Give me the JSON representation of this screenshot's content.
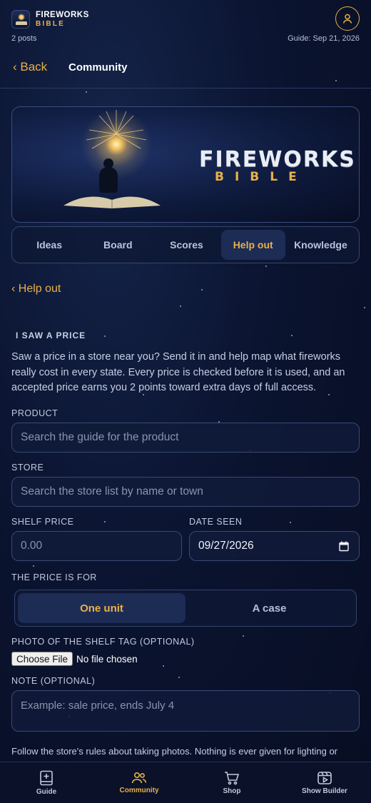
{
  "header": {
    "brand_line1": "FIREWORKS",
    "brand_line2": "BIBLE",
    "posts_count": "2 posts",
    "guide_date": "Guide: Sep 21, 2026"
  },
  "nav": {
    "back_label": "‹ Back",
    "title": "Community"
  },
  "banner": {
    "title": "FIREWORKS",
    "subtitle": "BIBLE"
  },
  "tabs": [
    {
      "label": "Ideas",
      "active": false
    },
    {
      "label": "Board",
      "active": false
    },
    {
      "label": "Scores",
      "active": false
    },
    {
      "label": "Help out",
      "active": true
    },
    {
      "label": "Knowledge",
      "active": false
    }
  ],
  "breadcrumb": "‹ Help out",
  "form": {
    "section_title": "I SAW A PRICE",
    "intro": "Saw a price in a store near you? Send it in and help map what fireworks really cost in every state. Every price is checked before it is used, and an accepted price earns you 2 points toward extra days of full access.",
    "product": {
      "label": "PRODUCT",
      "placeholder": "Search the guide for the product"
    },
    "store": {
      "label": "STORE",
      "placeholder": "Search the store list by name or town"
    },
    "shelf_price": {
      "label": "SHELF PRICE",
      "placeholder": "0.00"
    },
    "date_seen": {
      "label": "DATE SEEN",
      "value": "09/27/2026"
    },
    "price_for": {
      "label": "THE PRICE IS FOR",
      "options": [
        {
          "label": "One unit",
          "active": true
        },
        {
          "label": "A case",
          "active": false
        }
      ]
    },
    "photo": {
      "label": "PHOTO OF THE SHELF TAG (OPTIONAL)",
      "button": "Choose File",
      "status": "No file chosen"
    },
    "note": {
      "label": "NOTE (OPTIONAL)",
      "placeholder": "Example: sale price, ends July 4"
    },
    "footer": "Follow the store's rules about taking photos. Nothing is ever given for lighting or"
  },
  "bottom_nav": [
    {
      "label": "Guide",
      "icon": "book-plus-icon",
      "active": false
    },
    {
      "label": "Community",
      "icon": "people-icon",
      "active": true
    },
    {
      "label": "Shop",
      "icon": "cart-icon",
      "active": false
    },
    {
      "label": "Show Builder",
      "icon": "film-play-icon",
      "active": false
    }
  ],
  "colors": {
    "accent": "#e8b04a",
    "background": "#0b1430",
    "active_tab_bg": "#1d2c55"
  }
}
